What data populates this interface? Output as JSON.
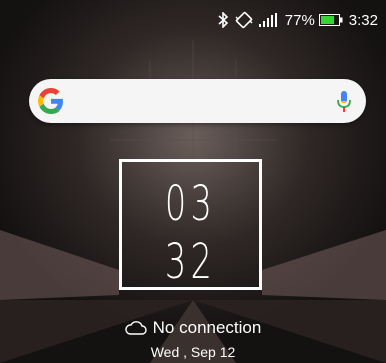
{
  "status_bar": {
    "bluetooth_icon": "bluetooth-icon",
    "vibrate_icon": "vibrate-icon",
    "signal_icon": "signal-icon",
    "battery_percent": "77%",
    "battery_level": 0.77,
    "battery_color": "#37d337",
    "time": "3:32"
  },
  "search_widget": {
    "logo_icon": "google-g-icon",
    "mic_icon": "mic-icon"
  },
  "clock": {
    "hours": "03",
    "minutes": "32"
  },
  "weather": {
    "icon": "cloud-icon",
    "label": "No connection"
  },
  "date": "Wed , Sep 12"
}
